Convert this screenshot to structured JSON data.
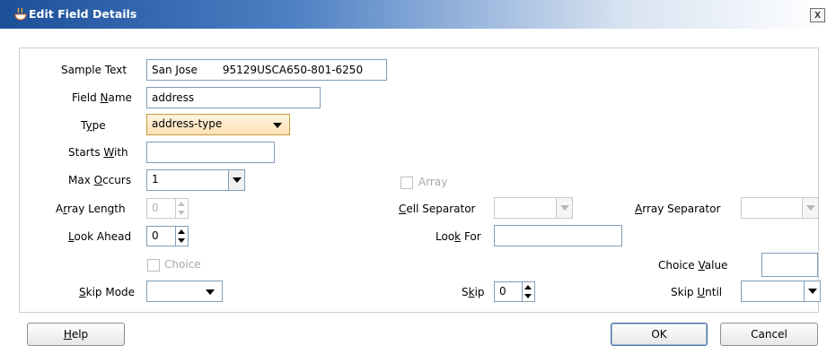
{
  "window": {
    "title": "Edit Field Details",
    "title_icon": "java-cup-icon",
    "close_label": "x"
  },
  "form": {
    "sample_text": {
      "label": "Sample Text",
      "value_part1": "San Jose",
      "value_part2": "95129USCA650-801-6250"
    },
    "field_name": {
      "label_pre": "Field ",
      "label_mn": "N",
      "label_post": "ame",
      "value": "address"
    },
    "type": {
      "label_pre": "T",
      "label_mn": "y",
      "label_post": "pe",
      "value": "address-type"
    },
    "starts_with": {
      "label_pre": "Starts ",
      "label_mn": "W",
      "label_post": "ith",
      "value": ""
    },
    "max_occurs": {
      "label_pre": "Max ",
      "label_mn": "O",
      "label_post": "ccurs",
      "value": "1"
    },
    "array_length": {
      "label_pre": "A",
      "label_mn": "r",
      "label_post": "ray Length",
      "value": "0"
    },
    "look_ahead": {
      "label_pre": "",
      "label_mn": "L",
      "label_post": "ook Ahead",
      "value": "0"
    },
    "choice": {
      "label": "Choice",
      "checked": false
    },
    "skip_mode": {
      "label_pre": "",
      "label_mn": "S",
      "label_post": "kip Mode",
      "value": ""
    },
    "array": {
      "label": "Array",
      "checked": false
    },
    "cell_separator": {
      "label_pre": "",
      "label_mn": "C",
      "label_post": "ell Separator",
      "value": ""
    },
    "look_for": {
      "label_pre": "Loo",
      "label_mn": "k",
      "label_post": " For",
      "value": ""
    },
    "skip": {
      "label_pre": "S",
      "label_mn": "k",
      "label_post": "ip",
      "value": "0"
    },
    "array_separator": {
      "label_pre": "",
      "label_mn": "A",
      "label_post": "rray Separator",
      "value": ""
    },
    "choice_value": {
      "label_pre": "Choice ",
      "label_mn": "V",
      "label_post": "alue",
      "value": ""
    },
    "skip_until": {
      "label_pre": "Skip ",
      "label_mn": "U",
      "label_post": "ntil",
      "value": ""
    }
  },
  "buttons": {
    "help_mn": "H",
    "help_rest": "elp",
    "ok": "OK",
    "cancel": "Cancel"
  },
  "colors": {
    "title_gradient_start": "#1b4f98",
    "field_border": "#7f9db9",
    "type_combo_highlight": "#ffe0b3",
    "disabled_text": "#a8a8a8"
  }
}
